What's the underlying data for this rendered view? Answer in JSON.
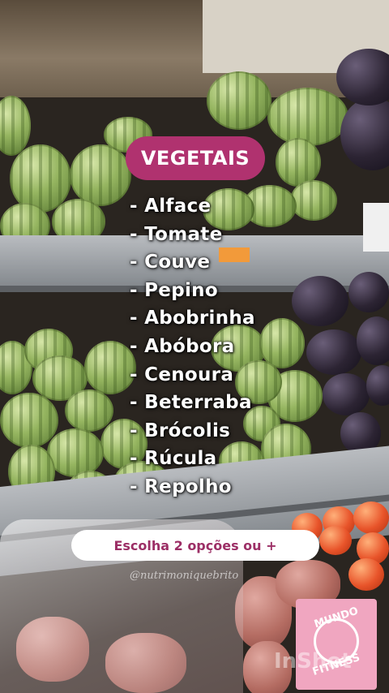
{
  "title": "VEGETAIS",
  "items": [
    "- Alface",
    "- Tomate",
    "- Couve",
    "- Pepino",
    "- Abobrinha",
    "- Abóbora",
    "- Cenoura",
    "- Beterraba",
    "- Brócolis",
    "- Rúcula",
    "- Repolho"
  ],
  "cta": "Escolha 2 opções ou +",
  "handle": "@nutrimoniquebrito",
  "badge": {
    "line1": "MUNDO",
    "line2": "FITNESS"
  },
  "watermark": "InShot",
  "colors": {
    "accent": "#b0326f",
    "cta_text": "#9c2f66",
    "badge_bg": "#f0a6c0"
  }
}
